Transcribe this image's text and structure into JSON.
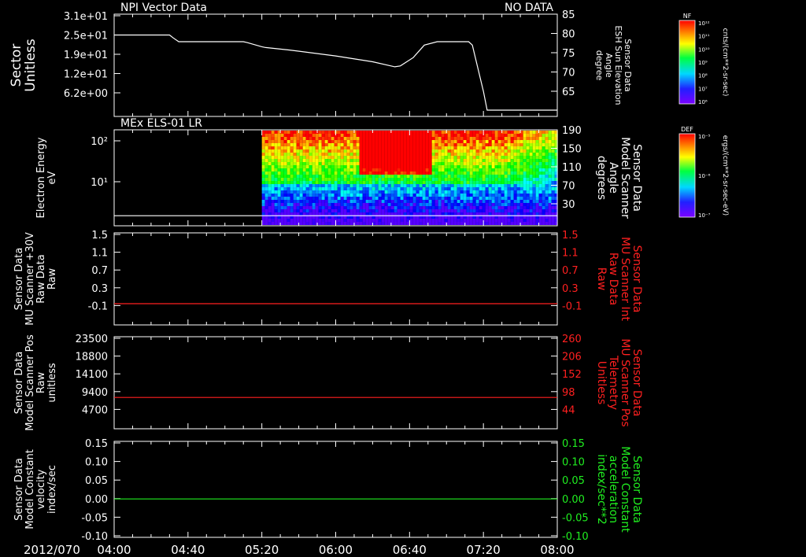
{
  "footer": {
    "date": "2012/070"
  },
  "time_ticks": [
    "04:00",
    "04:40",
    "05:20",
    "06:00",
    "06:40",
    "07:20",
    "08:00"
  ],
  "colorbars": [
    {
      "title": "NF",
      "unit": "cnts/(cm**2-sr-sec)",
      "ticks": [
        "10¹²",
        "10¹¹",
        "10¹⁰",
        "10⁹",
        "10⁸",
        "10⁷",
        "10⁶"
      ]
    },
    {
      "title": "DEF",
      "unit": "ergs/(cm**2-sr-sec-eV)",
      "ticks": [
        "10⁻⁵",
        "10⁻⁶",
        "10⁻⁷"
      ]
    }
  ],
  "colors": {
    "white": "#ffffff",
    "red": "#ff2020",
    "green": "#20ee20"
  },
  "chart_data": [
    {
      "type": "line",
      "title": "NPI Vector Data",
      "note": "NO DATA",
      "ylabel": [
        "Sector",
        "Unitless"
      ],
      "yticks": [
        "3.1e+01",
        "2.5e+01",
        "1.9e+01",
        "1.2e+01",
        "6.2e+00"
      ],
      "y2label": [
        "Sensor Data",
        "ESH Sun Elevation",
        "Angle",
        "degree"
      ],
      "y2ticks": [
        "85",
        "80",
        "75",
        "70",
        "65"
      ],
      "y2lim": [
        61.5,
        86
      ],
      "series": [
        {
          "color": "#ffffff",
          "x": [
            "04:00",
            "04:30",
            "04:32",
            "04:35",
            "05:10",
            "05:12",
            "05:20",
            "05:22",
            "05:35",
            "06:00",
            "06:20",
            "06:32",
            "06:35",
            "06:42",
            "06:48",
            "06:55",
            "07:00",
            "07:12",
            "07:14",
            "07:20",
            "07:22",
            "07:30",
            "08:00"
          ],
          "y": [
            81.0,
            81.0,
            80.3,
            79.4,
            79.4,
            79.2,
            78.2,
            78.0,
            77.4,
            76.0,
            74.6,
            73.4,
            73.6,
            75.6,
            78.6,
            79.4,
            79.4,
            79.4,
            78.6,
            67.5,
            63.0,
            63.0,
            63.0
          ]
        }
      ]
    },
    {
      "type": "heatmap",
      "title": "MEx ELS-01 LR",
      "ylabel": [
        "Electron Energy",
        "eV"
      ],
      "yticks": [
        "10²",
        "10¹"
      ],
      "y2label": [
        "Sensor Data",
        "Model Scanner",
        "Angle",
        "degrees"
      ],
      "y2ticks": [
        "190",
        "150",
        "110",
        "70",
        "30"
      ],
      "y2lim": [
        0,
        190
      ],
      "data_start": "05:20",
      "bright_region": {
        "from": "06:12",
        "to": "06:52"
      },
      "series": [
        {
          "color": "#ffffff",
          "x": [
            "04:00",
            "08:00"
          ],
          "y": [
            20,
            20
          ]
        }
      ]
    },
    {
      "type": "line",
      "ylabel": [
        "Sensor Data",
        "MU Scanner +30V",
        "Raw Data",
        "Raw"
      ],
      "yticks": [
        "1.5",
        "1.1",
        "0.7",
        "0.3",
        "-0.1"
      ],
      "ylim": [
        -0.45,
        1.5
      ],
      "y2label": [
        "Sensor Data",
        "MU Scanner Int",
        "Raw Data",
        "Raw"
      ],
      "y2ticks": [
        "1.5",
        "1.1",
        "0.7",
        "0.3",
        "-0.1"
      ],
      "series": [
        {
          "color": "#ff2020",
          "x": [
            "04:00",
            "08:00"
          ],
          "y": [
            0.0,
            0.0
          ]
        }
      ]
    },
    {
      "type": "line",
      "ylabel": [
        "Sensor Data",
        "Model Scanner Pos",
        "Raw",
        "unitless"
      ],
      "yticks": [
        "23500",
        "18800",
        "14100",
        "9400",
        "4700"
      ],
      "ylim": [
        0,
        23500
      ],
      "y2label": [
        "Sensor Data",
        "MU Scanner Pos",
        "Telemetry",
        "Unitless"
      ],
      "y2ticks": [
        "260",
        "206",
        "152",
        "98",
        "44"
      ],
      "series": [
        {
          "color": "#ff2020",
          "x": [
            "04:00",
            "08:00"
          ],
          "y": [
            8000,
            8000
          ]
        }
      ]
    },
    {
      "type": "line",
      "ylabel": [
        "Sensor Data",
        "Model Constant",
        "velocity",
        "index/sec"
      ],
      "yticks": [
        "0.15",
        "0.10",
        "0.05",
        "0.00",
        "-0.05",
        "-0.10"
      ],
      "ylim": [
        -0.1,
        0.15
      ],
      "y2label": [
        "Sensor Data",
        "Model Constant",
        "acceleration",
        "index/sec**2"
      ],
      "y2ticks": [
        "0.15",
        "0.10",
        "0.05",
        "0.00",
        "-0.05",
        "-0.10"
      ],
      "series": [
        {
          "color": "#20ee20",
          "x": [
            "04:00",
            "08:00"
          ],
          "y": [
            0.0,
            0.0
          ]
        }
      ]
    }
  ]
}
